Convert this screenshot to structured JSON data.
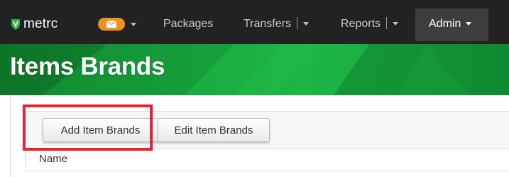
{
  "nav": {
    "brand": "metrc",
    "items": [
      {
        "label": "Packages"
      },
      {
        "label": "Transfers"
      },
      {
        "label": "Reports"
      },
      {
        "label": "Admin"
      }
    ],
    "mail_color": "#f0901e"
  },
  "page": {
    "title": "Items Brands"
  },
  "toolbar": {
    "add_label": "Add Item Brands",
    "edit_label": "Edit Item Brands"
  },
  "grid": {
    "columns": [
      "Name"
    ]
  },
  "colors": {
    "navbar": "#222222",
    "banner": "#17a23a",
    "highlight": "#e8232b"
  }
}
